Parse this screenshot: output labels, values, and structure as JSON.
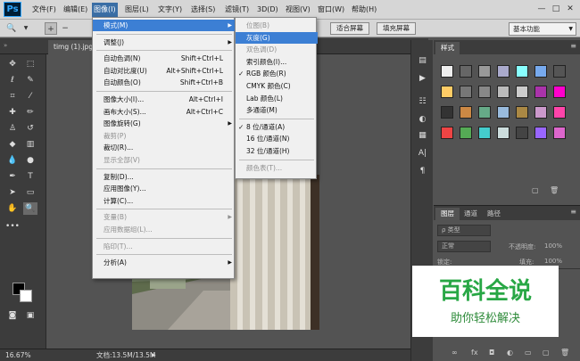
{
  "app": {
    "logo": "Ps"
  },
  "menubar": {
    "items": [
      "文件(F)",
      "编辑(E)",
      "图像(I)",
      "图层(L)",
      "文字(Y)",
      "选择(S)",
      "滤镜(T)",
      "3D(D)",
      "视图(V)",
      "窗口(W)",
      "帮助(H)"
    ],
    "active_index": 2
  },
  "window_controls": {
    "minimize": "—",
    "maximize": "□",
    "close": "✕"
  },
  "options_bar": {
    "fit_screen": "适合屏幕",
    "fill_screen": "填充屏幕",
    "workspace": "基本功能"
  },
  "document": {
    "tab_title": "timg (1).jpg"
  },
  "status": {
    "zoom": "16.67%",
    "doc_size": "文档:13.5M/13.5M"
  },
  "image_menu": {
    "items": [
      {
        "label": "模式(M)",
        "submenu": true,
        "highlighted": true
      },
      {
        "sep": true
      },
      {
        "label": "调整(J)",
        "submenu": true
      },
      {
        "sep": true
      },
      {
        "label": "自动色调(N)",
        "shortcut": "Shift+Ctrl+L"
      },
      {
        "label": "自动对比度(U)",
        "shortcut": "Alt+Shift+Ctrl+L"
      },
      {
        "label": "自动颜色(O)",
        "shortcut": "Shift+Ctrl+B"
      },
      {
        "sep": true
      },
      {
        "label": "图像大小(I)...",
        "shortcut": "Alt+Ctrl+I"
      },
      {
        "label": "画布大小(S)...",
        "shortcut": "Alt+Ctrl+C"
      },
      {
        "label": "图像旋转(G)",
        "submenu": true
      },
      {
        "label": "裁剪(P)",
        "disabled": true
      },
      {
        "label": "裁切(R)..."
      },
      {
        "label": "显示全部(V)",
        "disabled": true
      },
      {
        "sep": true
      },
      {
        "label": "复制(D)..."
      },
      {
        "label": "应用图像(Y)..."
      },
      {
        "label": "计算(C)..."
      },
      {
        "sep": true
      },
      {
        "label": "变量(B)",
        "submenu": true,
        "disabled": true
      },
      {
        "label": "应用数据组(L)...",
        "disabled": true
      },
      {
        "sep": true
      },
      {
        "label": "陷印(T)...",
        "disabled": true
      },
      {
        "sep": true
      },
      {
        "label": "分析(A)",
        "submenu": true
      }
    ]
  },
  "mode_menu": {
    "items": [
      {
        "label": "位图(B)",
        "disabled": true
      },
      {
        "label": "灰度(G)",
        "highlighted": true
      },
      {
        "label": "双色调(D)",
        "disabled": true
      },
      {
        "label": "索引颜色(I)..."
      },
      {
        "label": "RGB 颜色(R)",
        "checked": true
      },
      {
        "label": "CMYK 颜色(C)"
      },
      {
        "label": "Lab 颜色(L)"
      },
      {
        "label": "多通道(M)"
      },
      {
        "sep": true
      },
      {
        "label": "8 位/通道(A)",
        "checked": true
      },
      {
        "label": "16 位/通道(N)"
      },
      {
        "label": "32 位/通道(H)"
      },
      {
        "sep": true
      },
      {
        "label": "颜色表(T)...",
        "disabled": true
      }
    ]
  },
  "styles_panel": {
    "tab": "样式"
  },
  "layers_panel": {
    "tabs": [
      "图层",
      "通道",
      "路径"
    ],
    "kind_filter": "ρ 类型",
    "blend_mode": "正常",
    "opacity_label": "不透明度:",
    "opacity_value": "100%",
    "lock_label": "锁定:",
    "fill_label": "填充:",
    "fill_value": "100%"
  },
  "watermark": {
    "title": "百科全说",
    "subtitle": "助你轻松解决"
  },
  "colors": {
    "accent": "#3c7fd4",
    "menu_bg": "#f0f0f0",
    "panel_bg": "#535353",
    "watermark_green": "#28a745"
  }
}
